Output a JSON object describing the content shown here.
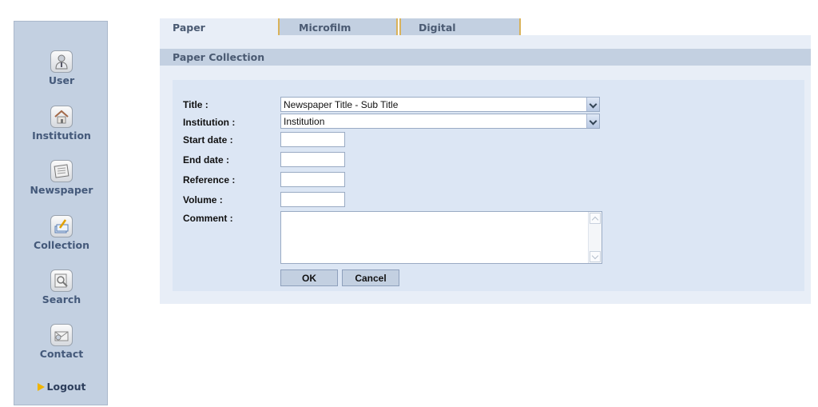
{
  "sidebar": {
    "items": [
      {
        "label": "User",
        "icon": "user-icon"
      },
      {
        "label": "Institution",
        "icon": "house-icon"
      },
      {
        "label": "Newspaper",
        "icon": "newspaper-icon"
      },
      {
        "label": "Collection",
        "icon": "collection-icon"
      },
      {
        "label": "Search",
        "icon": "search-icon"
      },
      {
        "label": "Contact",
        "icon": "mail-icon"
      }
    ],
    "logout_label": "Logout"
  },
  "tabs": [
    {
      "label": "Paper",
      "active": true
    },
    {
      "label": "Microfilm",
      "active": false
    },
    {
      "label": "Digital",
      "active": false
    }
  ],
  "section_title": "Paper Collection",
  "form": {
    "title_label": "Title :",
    "title_value": "Newspaper Title - Sub Title",
    "institution_label": "Institution :",
    "institution_value": "Institution",
    "start_date_label": "Start date :",
    "start_date_value": "",
    "end_date_label": "End date :",
    "end_date_value": "",
    "reference_label": "Reference :",
    "reference_value": "",
    "volume_label": "Volume :",
    "volume_value": "",
    "comment_label": "Comment :",
    "comment_value": "",
    "ok_label": "OK",
    "cancel_label": "Cancel"
  },
  "colors": {
    "sidebar_bg": "#c3d0e1",
    "panel_bg": "#e8eef7",
    "form_bg": "#dce6f4",
    "label_color": "#4a5a72",
    "logout_arrow": "#f0b400"
  }
}
